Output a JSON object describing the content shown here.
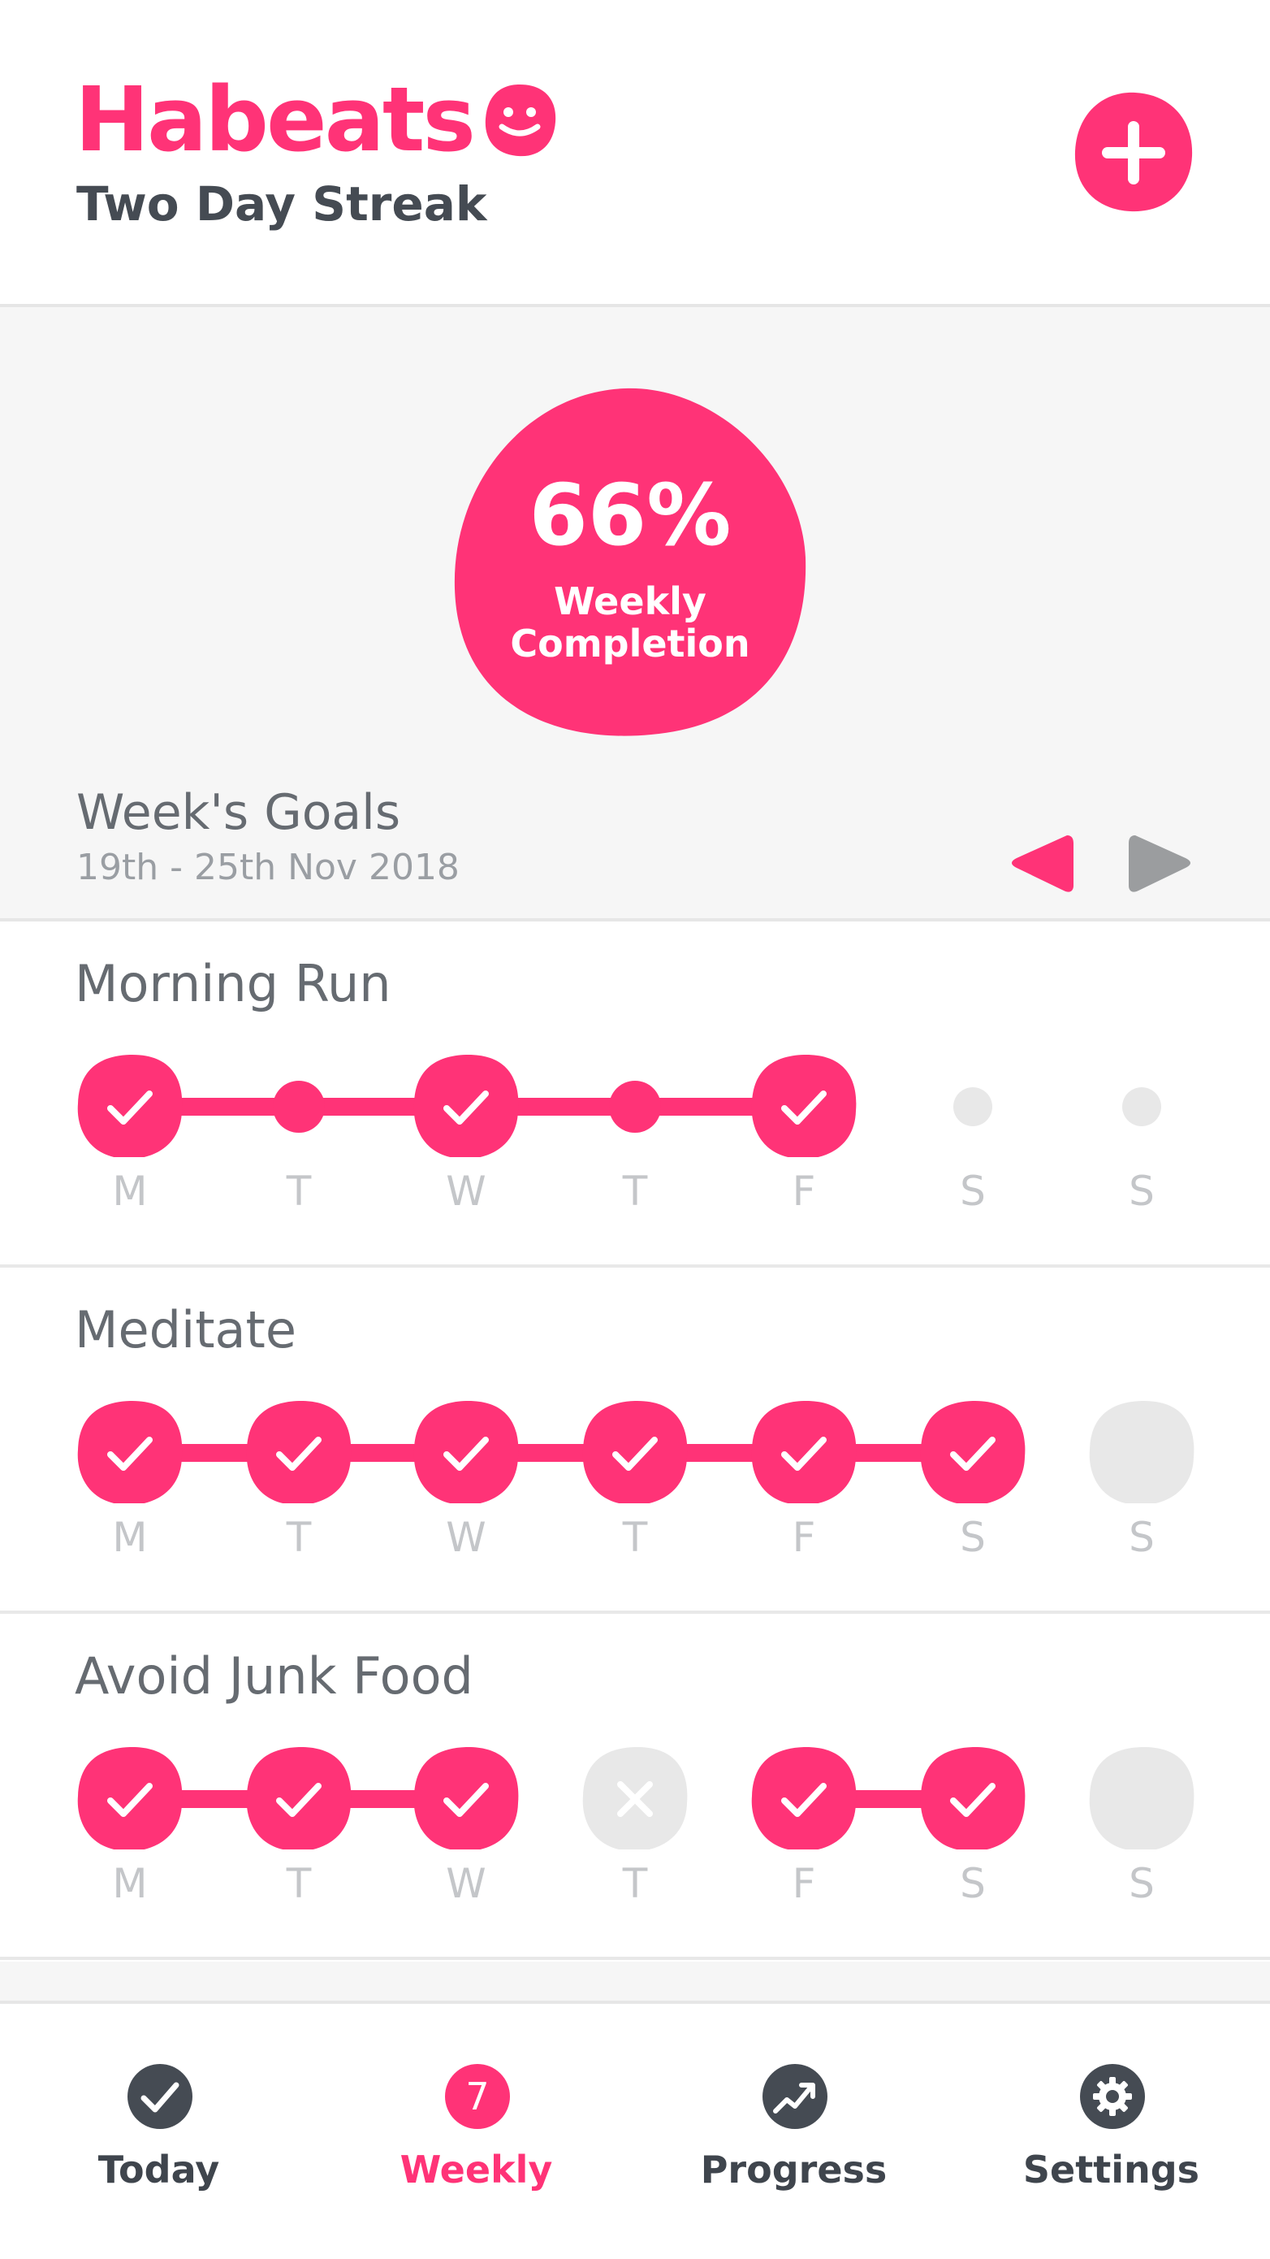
{
  "theme": {
    "accent": "#ff3377",
    "inactive": "#e8e8e8",
    "text_dark": "#454b53",
    "text_muted": "#9a9ea3"
  },
  "header": {
    "app_title": "Habeats",
    "logo_icon": "smiley-face-icon",
    "streak": "Two Day Streak",
    "add_icon": "plus-icon"
  },
  "summary": {
    "percent": "66%",
    "label_line1": "Weekly",
    "label_line2": "Completion",
    "completion_fraction": 0.66
  },
  "week": {
    "title": "Week's Goals",
    "range": "19th - 25th Nov 2018",
    "prev_icon": "triangle-left-icon",
    "next_icon": "triangle-right-icon"
  },
  "days": [
    "M",
    "T",
    "W",
    "T",
    "F",
    "S",
    "S"
  ],
  "habits": [
    {
      "name": "Morning Run",
      "status": [
        "done",
        "rest",
        "done",
        "rest",
        "done",
        "rest-pending",
        "rest-pending"
      ]
    },
    {
      "name": "Meditate",
      "status": [
        "done",
        "done",
        "done",
        "done",
        "done",
        "done",
        "pending"
      ]
    },
    {
      "name": "Avoid Junk Food",
      "status": [
        "done",
        "done",
        "done",
        "missed",
        "done",
        "done",
        "pending"
      ]
    }
  ],
  "tabs": [
    {
      "label": "Today",
      "icon": "check-circle-icon",
      "active": false
    },
    {
      "label": "Weekly",
      "icon": "calendar-seven-icon",
      "badge": "7",
      "active": true
    },
    {
      "label": "Progress",
      "icon": "trend-chart-icon",
      "active": false
    },
    {
      "label": "Settings",
      "icon": "gear-icon",
      "active": false
    }
  ]
}
